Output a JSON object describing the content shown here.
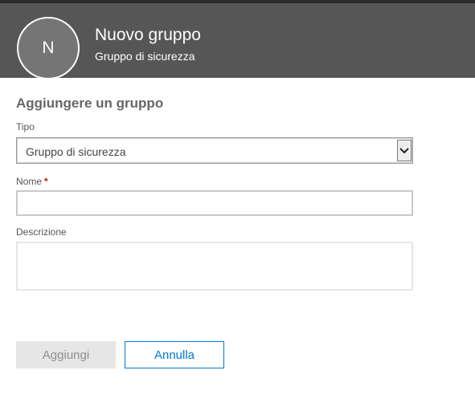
{
  "header": {
    "avatar_initial": "N",
    "title": "Nuovo gruppo",
    "subtitle": "Gruppo di sicurezza"
  },
  "form": {
    "section_title": "Aggiungere un gruppo",
    "type_label": "Tipo",
    "type_value": "Gruppo di sicurezza",
    "name_label": "Nome",
    "name_required_mark": "*",
    "name_value": "",
    "description_label": "Descrizione",
    "description_value": ""
  },
  "buttons": {
    "add_label": "Aggiungi",
    "add_enabled": false,
    "cancel_label": "Annulla"
  },
  "colors": {
    "header_bg": "#565656",
    "avatar_bg": "#757575",
    "accent": "#0078d7",
    "required": "#c4161c"
  },
  "icons": {
    "select_arrow": "chevron-down-icon"
  }
}
